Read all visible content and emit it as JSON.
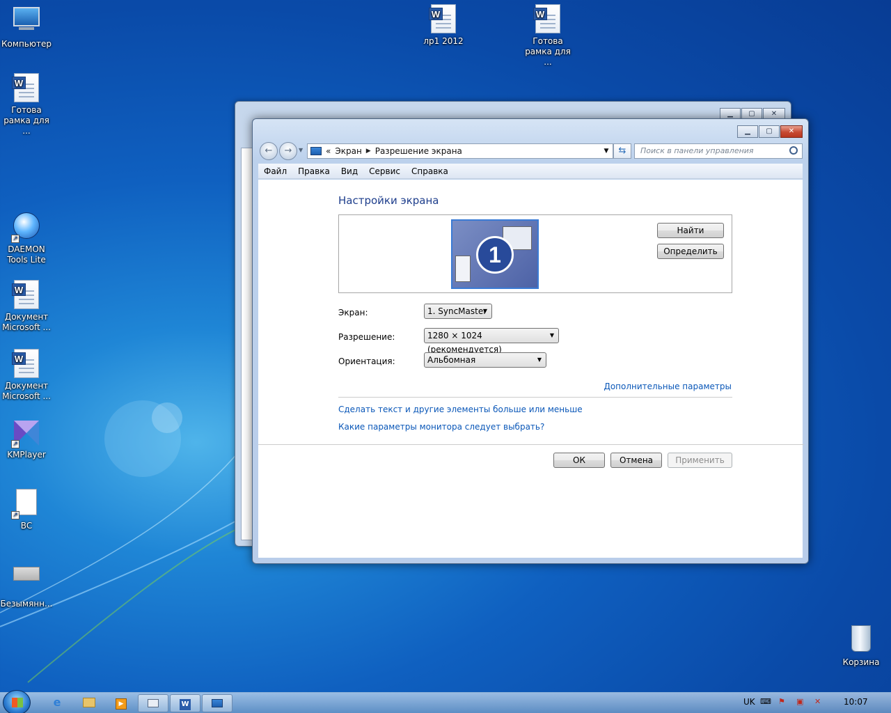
{
  "desktop": {
    "icons": [
      {
        "label": "Компьютер"
      },
      {
        "label": "лр1 2012"
      },
      {
        "label": "Готова рамка для ..."
      },
      {
        "label": "Готова рамка для ..."
      },
      {
        "label": "DAEMON Tools Lite"
      },
      {
        "label": "Документ Microsoft ..."
      },
      {
        "label": "Документ Microsoft ..."
      },
      {
        "label": "KMPlayer"
      },
      {
        "label": "BC"
      },
      {
        "label": "Безымянн..."
      },
      {
        "label": "Корзина"
      }
    ]
  },
  "window": {
    "breadcrumb": [
      "Экран",
      "Разрешение экрана"
    ],
    "breadcrumb_prefix": "«",
    "search_placeholder": "Поиск в панели управления",
    "menu": [
      "Файл",
      "Правка",
      "Вид",
      "Сервис",
      "Справка"
    ],
    "title": "Настройки экрана",
    "monitor_number": "1",
    "buttons": {
      "detect_find": "Найти",
      "identify": "Определить",
      "ok": "ОК",
      "cancel": "Отмена",
      "apply": "Применить"
    },
    "fields": {
      "screen_label": "Экран:",
      "screen_value": "1. SyncMaster",
      "resolution_label": "Разрешение:",
      "resolution_value": "1280 × 1024 (рекомендуется)",
      "orientation_label": "Ориентация:",
      "orientation_value": "Альбомная"
    },
    "links": {
      "advanced": "Дополнительные параметры",
      "text_size": "Сделать текст и другие элементы больше или меньше",
      "which_settings": "Какие параметры монитора следует выбрать?"
    }
  },
  "taskbar": {
    "language": "UK",
    "clock": "10:07"
  }
}
